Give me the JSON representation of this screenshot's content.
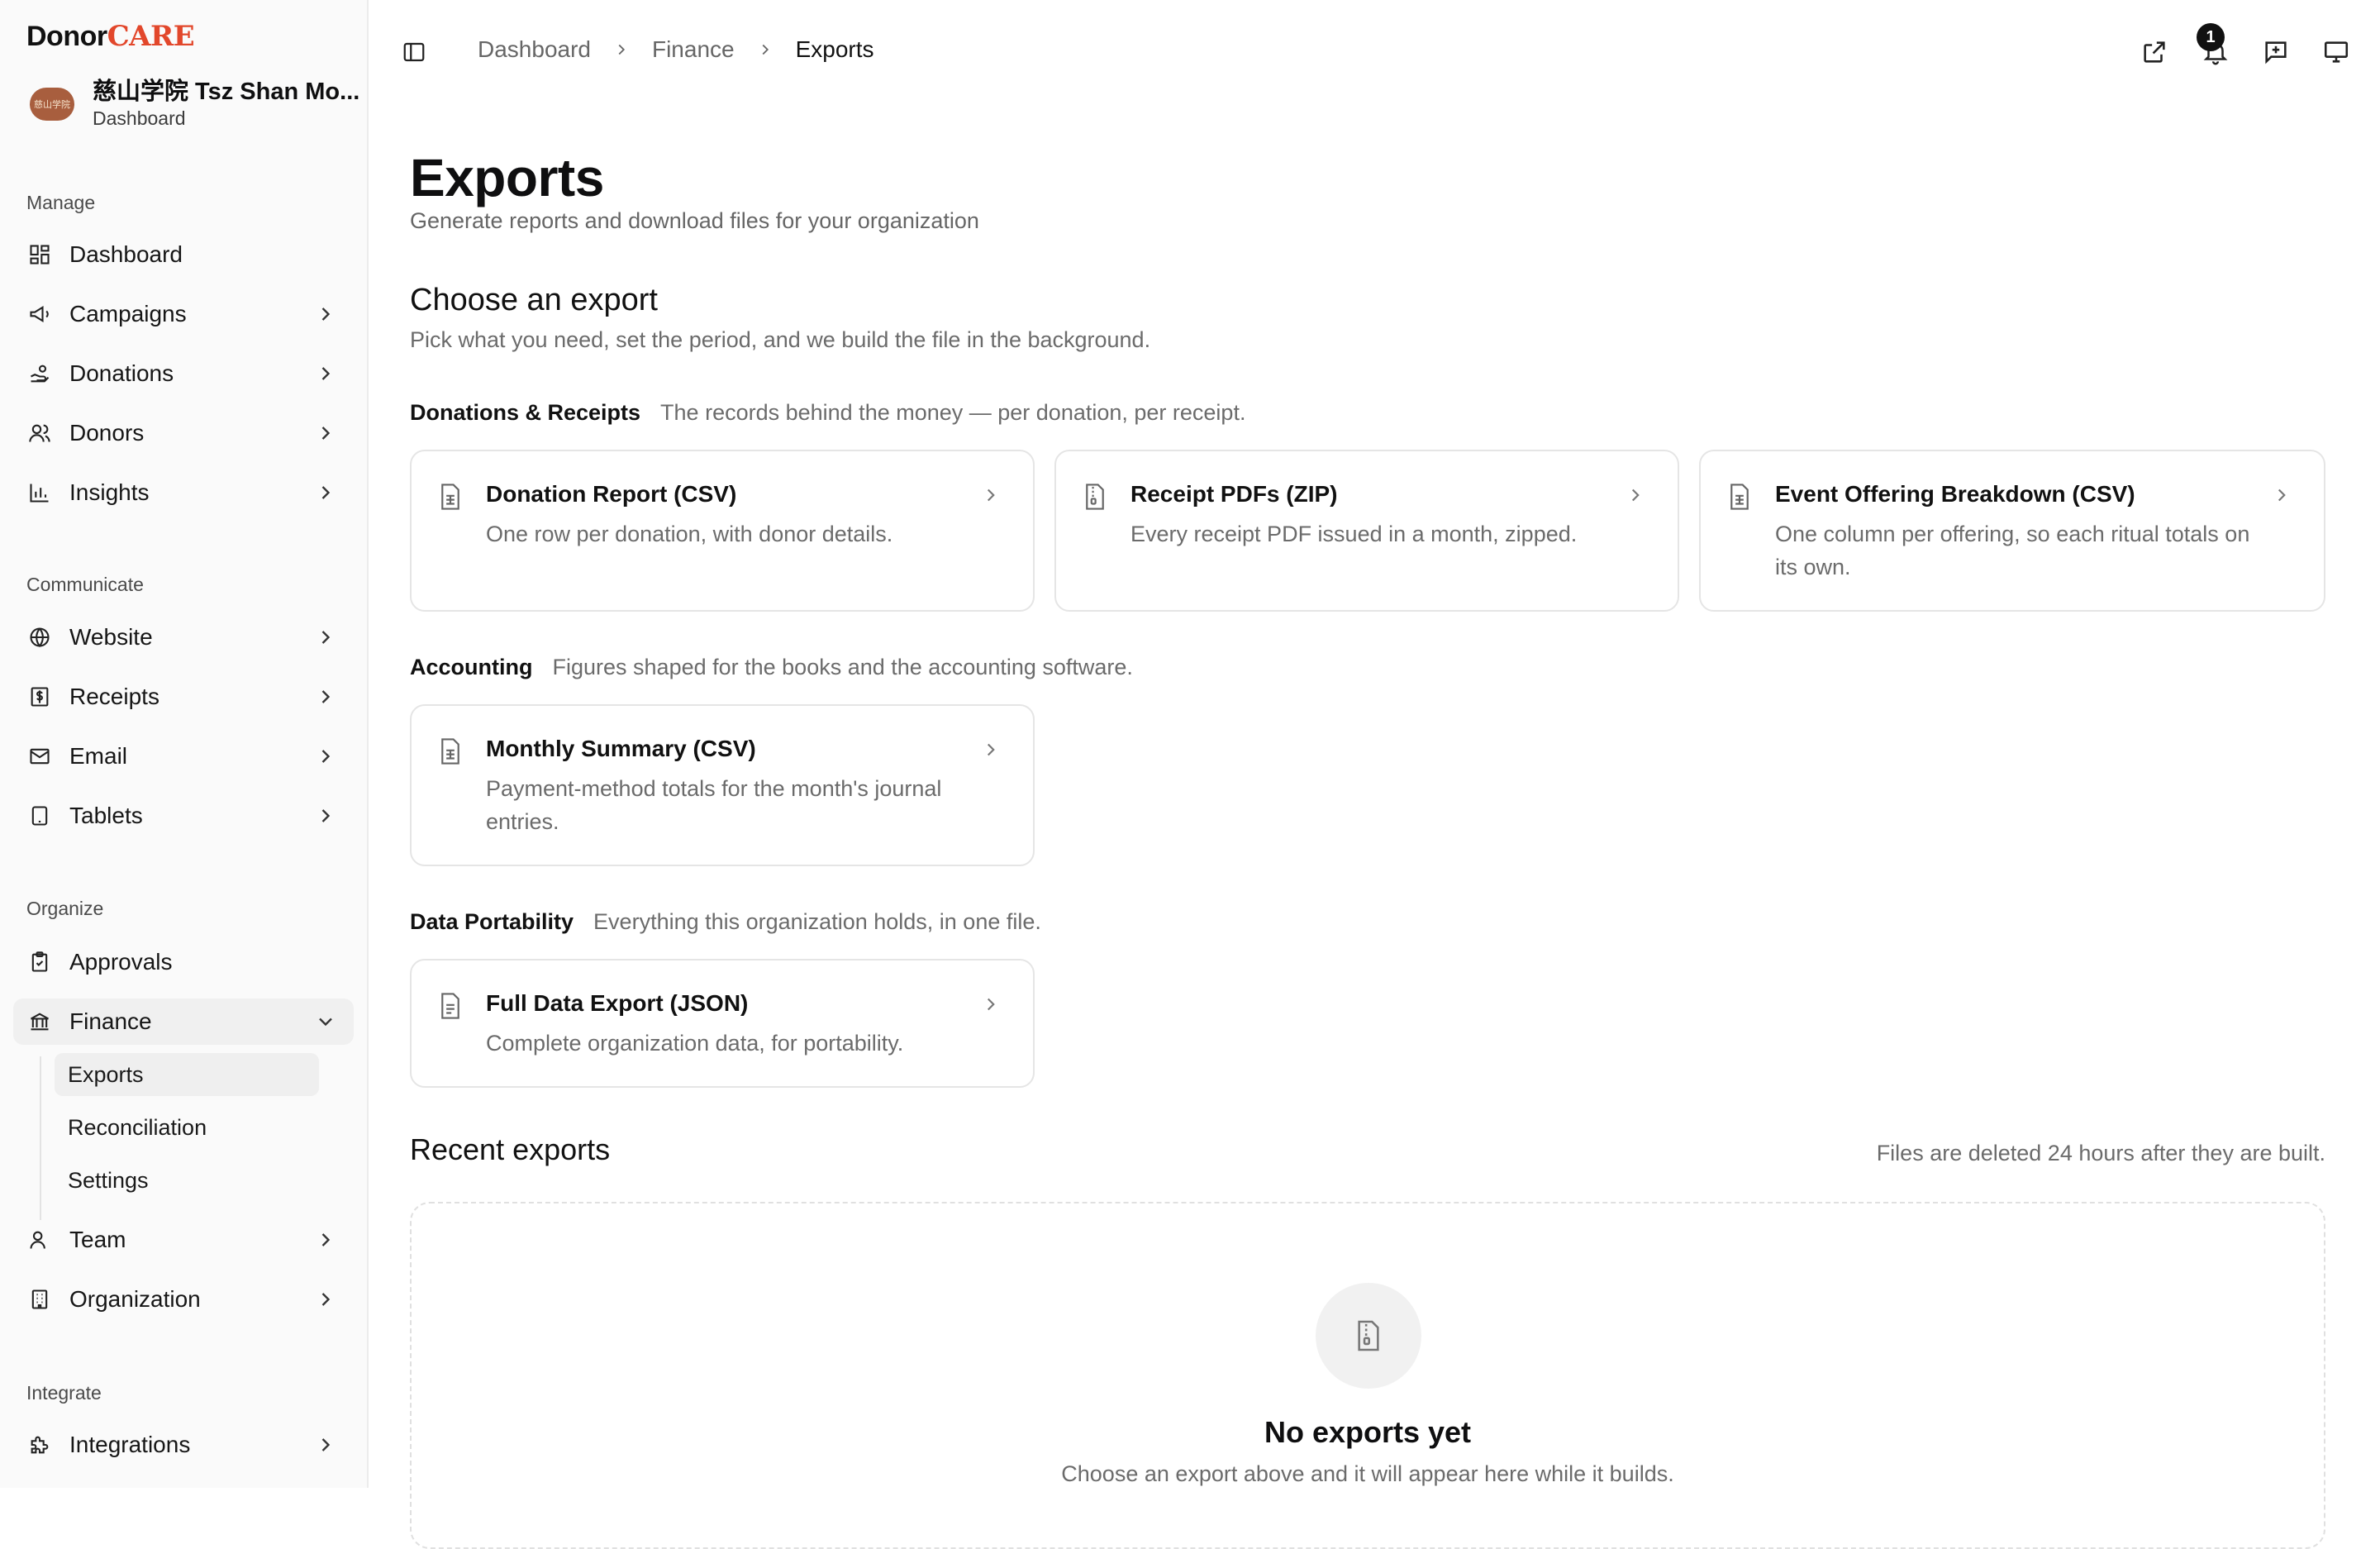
{
  "brand": {
    "part1": "Donor",
    "part2": "CARE",
    "accent": "#e2472b"
  },
  "org": {
    "name": "慈山学院 Tsz Shan Mo...",
    "subtitle": "Dashboard",
    "logo_text": "慈山学院"
  },
  "sidebar": {
    "sections": {
      "manage": "Manage",
      "communicate": "Communicate",
      "organize": "Organize",
      "integrate": "Integrate"
    },
    "items": {
      "dashboard": "Dashboard",
      "campaigns": "Campaigns",
      "donations": "Donations",
      "donors": "Donors",
      "insights": "Insights",
      "website": "Website",
      "receipts": "Receipts",
      "email": "Email",
      "tablets": "Tablets",
      "approvals": "Approvals",
      "finance": "Finance",
      "team": "Team",
      "organization": "Organization",
      "integrations": "Integrations"
    },
    "finance_sub": {
      "exports": "Exports",
      "reconciliation": "Reconciliation",
      "settings": "Settings"
    }
  },
  "breadcrumb": [
    "Dashboard",
    "Finance",
    "Exports"
  ],
  "notifications": {
    "count": "1"
  },
  "page": {
    "title": "Exports",
    "subtitle": "Generate reports and download files for your organization"
  },
  "choose": {
    "title": "Choose an export",
    "description": "Pick what you need, set the period, and we build the file in the background."
  },
  "groups": [
    {
      "title": "Donations & Receipts",
      "description": "The records behind the money — per donation, per receipt.",
      "cards": [
        {
          "title": "Donation Report (CSV)",
          "description": "One row per donation, with donor details."
        },
        {
          "title": "Receipt PDFs (ZIP)",
          "description": "Every receipt PDF issued in a month, zipped."
        },
        {
          "title": "Event Offering Breakdown (CSV)",
          "description": "One column per offering, so each ritual totals on its own."
        }
      ]
    },
    {
      "title": "Accounting",
      "description": "Figures shaped for the books and the accounting software.",
      "cards": [
        {
          "title": "Monthly Summary (CSV)",
          "description": "Payment-method totals for the month's journal entries."
        }
      ]
    },
    {
      "title": "Data Portability",
      "description": "Everything this organization holds, in one file.",
      "cards": [
        {
          "title": "Full Data Export (JSON)",
          "description": "Complete organization data, for portability."
        }
      ]
    }
  ],
  "recent": {
    "title": "Recent exports",
    "note": "Files are deleted 24 hours after they are built.",
    "empty_title": "No exports yet",
    "empty_description": "Choose an export above and it will appear here while it builds."
  }
}
